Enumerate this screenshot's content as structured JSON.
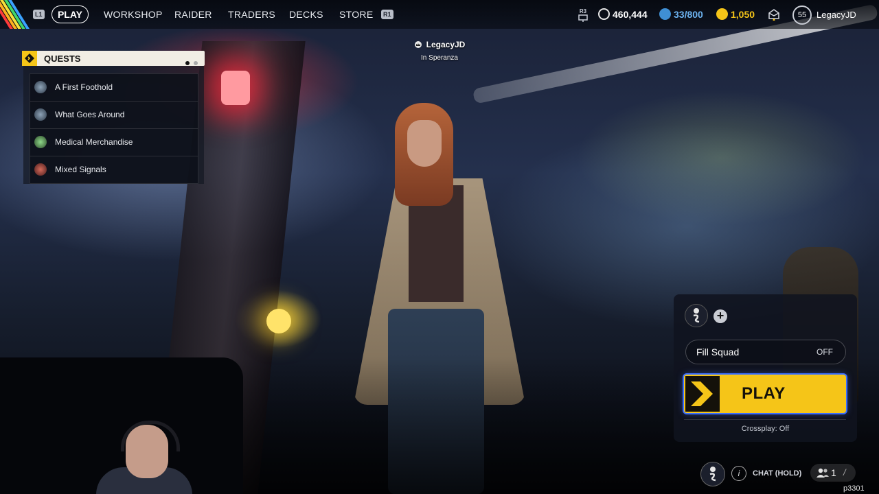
{
  "nav": {
    "left_key": "L1",
    "right_key": "R1",
    "items": [
      "PLAY",
      "WORKSHOP",
      "RAIDER",
      "TRADERS",
      "DECKS",
      "STORE"
    ],
    "active": "PLAY"
  },
  "status": {
    "r3_label": "R3",
    "coins": "460,444",
    "capacity": "33/800",
    "tokens": "1,050",
    "level": "55",
    "username": "LegacyJD"
  },
  "player": {
    "name": "LegacyJD",
    "location": "In Speranza"
  },
  "quests": {
    "title": "QUESTS",
    "items": [
      {
        "label": "A First Foothold",
        "icon": "quest-icon"
      },
      {
        "label": "What Goes Around",
        "icon": "quest-icon"
      },
      {
        "label": "Medical Merchandise",
        "icon": "quest-icon"
      },
      {
        "label": "Mixed Signals",
        "icon": "quest-icon"
      }
    ]
  },
  "panel": {
    "fill_squad_label": "Fill Squad",
    "fill_squad_value": "OFF",
    "play_label": "PLAY",
    "crossplay": "Crossplay: Off"
  },
  "bottom": {
    "chat_label": "CHAT (HOLD)",
    "friends_count": "1",
    "chat_glyph": "i",
    "version": "p3301"
  },
  "colors": {
    "accent": "#f5c518",
    "panel": "#10131f"
  }
}
